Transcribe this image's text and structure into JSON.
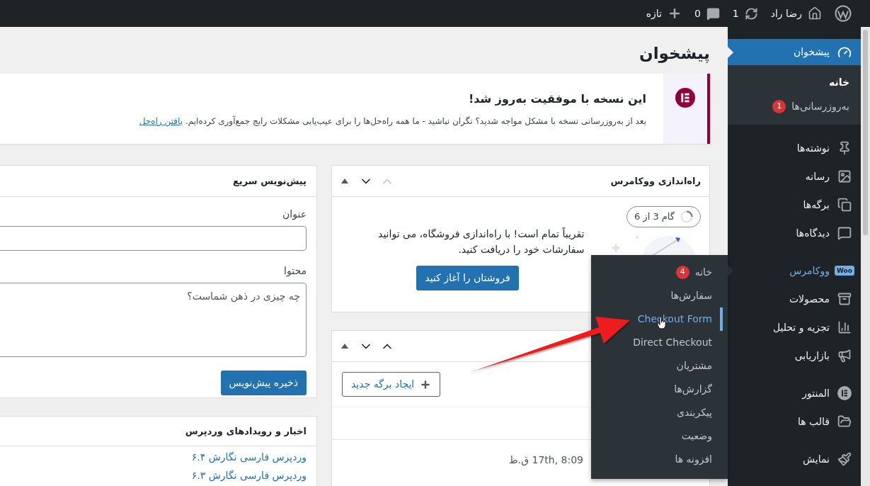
{
  "admin_bar": {
    "new_label": "تازه",
    "comments_count": "0",
    "updates_count": "1",
    "site_name": "رضا راد"
  },
  "sidebar": {
    "groups": [
      [
        {
          "label": "پیشخوان",
          "selected": true,
          "submenu": [
            {
              "label": "خانه",
              "selected": true
            },
            {
              "label": "به‌روزرسانی‌ها",
              "selected": false,
              "badge": "1"
            }
          ]
        }
      ],
      [
        {
          "label": "نوشته‌ها",
          "selected": false
        },
        {
          "label": "رسانه",
          "selected": false
        },
        {
          "label": "برگه‌ها",
          "selected": false
        },
        {
          "label": "دیدگاه‌ها",
          "selected": false
        }
      ],
      [
        {
          "label": "ووکامرس",
          "selected": false,
          "highlighted": true,
          "icon_text": "Woo",
          "flyout": [
            {
              "label": "خانه",
              "selected": false,
              "badge": "4"
            },
            {
              "label": "سفارش‌ها",
              "selected": false
            },
            {
              "label": "Checkout Form",
              "selected": true
            },
            {
              "label": "Direct Checkout",
              "selected": false
            },
            {
              "label": "مشتریان",
              "selected": false
            },
            {
              "label": "گزارش‌ها",
              "selected": false
            },
            {
              "label": "پیکربندی",
              "selected": false
            },
            {
              "label": "وضعیت",
              "selected": false
            },
            {
              "label": "افزونه ها",
              "selected": false
            }
          ]
        },
        {
          "label": "محصولات",
          "selected": false
        },
        {
          "label": "تجزیه و تحلیل",
          "selected": false
        },
        {
          "label": "بازاریابی",
          "selected": false
        }
      ],
      [
        {
          "label": "المنتور",
          "selected": false
        },
        {
          "label": "قالب ها",
          "selected": false
        }
      ],
      [
        {
          "label": "نمایش",
          "selected": false
        }
      ]
    ]
  },
  "page": {
    "title": "پیشخوان"
  },
  "notice": {
    "title": "این نسخه با موفقیت به‌روز شد!",
    "text": "بعد از به‌روزرسانی نسخه با مشکل مواجه شدید؟ نگران نباشید - ما همه راه‌حل‌ها را برای عیب‌یابی مشکلات رایج جمع‌آوری کرده‌ایم.",
    "link": "یافتن راه‌حل"
  },
  "setup_box": {
    "title": "راه‌اندازی ووکامرس",
    "move_up_disabled": true,
    "step": "گام 3 از 6",
    "message": "تقریباً تمام است! با راه‌اندازی فروشگاه، می توانید سفارشات خود را دریافت کنید.",
    "button": "فروشتان را آغاز کنید"
  },
  "pages_box": {
    "move_up_disabled": false,
    "button": "ایجاد برگه جدید",
    "date": "17th, 8:09 ق.ظ"
  },
  "quick_draft": {
    "title": "پیش‌نویس سریع",
    "title_field": {
      "label": "عنوان"
    },
    "content_field": {
      "label": "محتوا",
      "placeholder": "چه چیزی در ذهن شماست؟"
    },
    "button": "ذخیره پیش‌نویس"
  },
  "news": {
    "title": "اخبار و رویدادهای وردپرس",
    "links": [
      "وردپرس فارسی نگارش ۶.۴",
      "وردپرس فارسی نگارش ۶.۳"
    ]
  }
}
